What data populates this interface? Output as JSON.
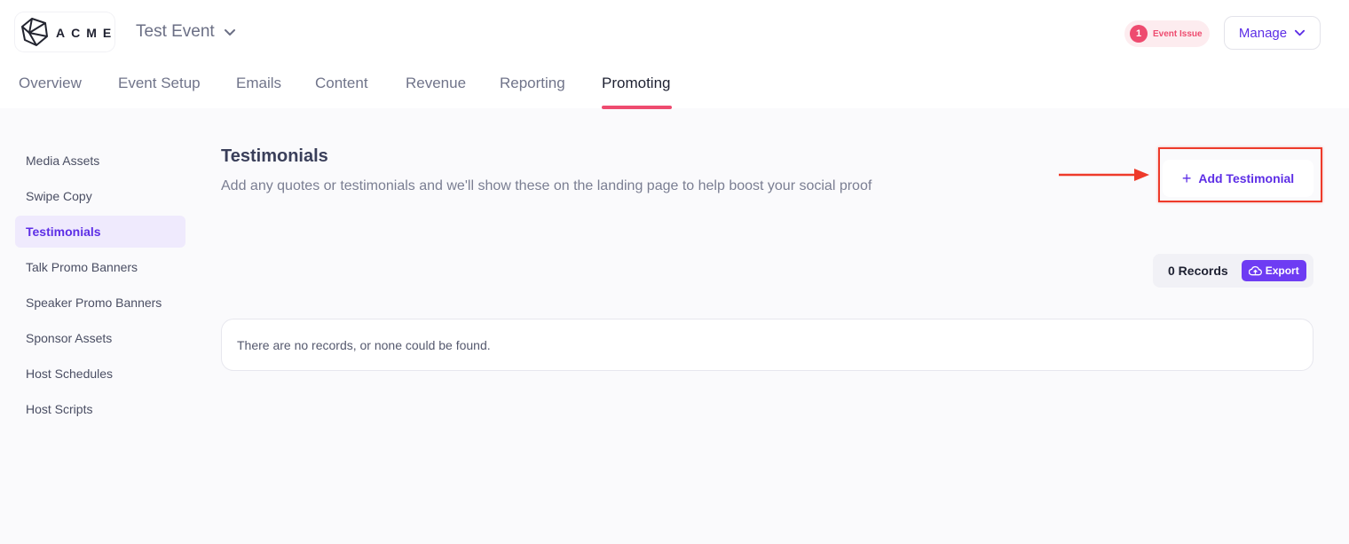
{
  "header": {
    "logo_text": "ACME",
    "event_name": "Test Event",
    "issue_count": "1",
    "issue_label": "Event Issue",
    "manage_label": "Manage"
  },
  "tabs": [
    {
      "label": "Overview",
      "active": false
    },
    {
      "label": "Event Setup",
      "active": false
    },
    {
      "label": "Emails",
      "active": false
    },
    {
      "label": "Content",
      "active": false
    },
    {
      "label": "Revenue",
      "active": false
    },
    {
      "label": "Reporting",
      "active": false
    },
    {
      "label": "Promoting",
      "active": true
    }
  ],
  "sidebar": {
    "items": [
      {
        "label": "Media Assets",
        "active": false
      },
      {
        "label": "Swipe Copy",
        "active": false
      },
      {
        "label": "Testimonials",
        "active": true
      },
      {
        "label": "Talk Promo Banners",
        "active": false
      },
      {
        "label": "Speaker Promo Banners",
        "active": false
      },
      {
        "label": "Sponsor Assets",
        "active": false
      },
      {
        "label": "Host Schedules",
        "active": false
      },
      {
        "label": "Host Scripts",
        "active": false
      }
    ]
  },
  "main": {
    "title": "Testimonials",
    "description": "Add any quotes or testimonials and we'll show these on the landing page to help boost your social proof",
    "add_button_label": "Add Testimonial",
    "records_label": "0 Records",
    "export_label": "Export",
    "empty_message": "There are no records, or none could be found."
  },
  "icons": {
    "logo": "acme-logo-icon",
    "event_chevron": "chevron-down-icon",
    "manage_chevron": "chevron-down-icon",
    "add": "plus-icon",
    "export": "cloud-upload-icon",
    "annotation": "arrow-right-icon"
  },
  "colors": {
    "accent": "#5d2ee6",
    "tab_underline": "#ee4b6f",
    "issue_badge": "#ee4b6f",
    "export_button": "#6e3cf3",
    "annotation": "#ee3a2a",
    "background": "#fafafc"
  }
}
